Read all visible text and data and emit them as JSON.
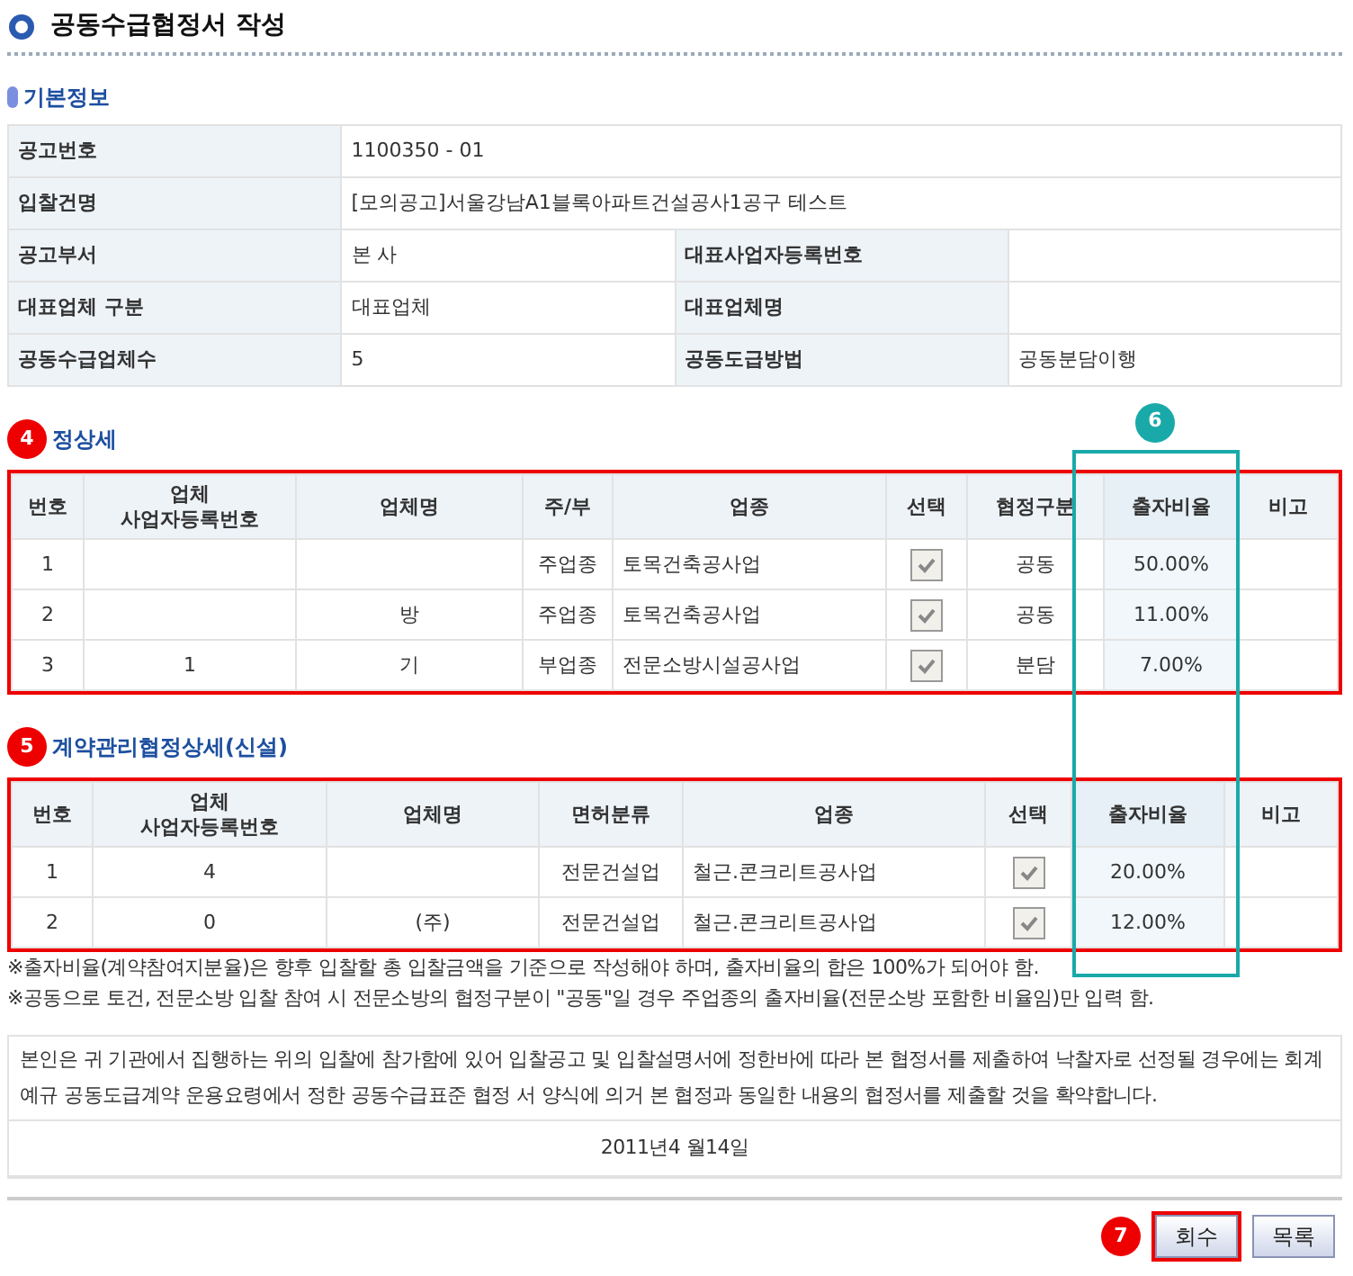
{
  "page_title": "공동수급협정서 작성",
  "basic_info": {
    "heading": "기본정보",
    "rows": [
      [
        {
          "label": "공고번호",
          "value": "1100350 - 01"
        }
      ],
      [
        {
          "label": "입찰건명",
          "value": "[모의공고]서울강남A1블록아파트건설공사1공구 테스트"
        }
      ],
      [
        {
          "label": "공고부서",
          "value": "본 사"
        },
        {
          "label": "대표사업자등록번호"
        }
      ],
      [
        {
          "label": "대표업체 구분",
          "value": "대표업체"
        },
        {
          "label": "대표업체명"
        }
      ],
      [
        {
          "label": "공동수급업체수",
          "value": "5"
        },
        {
          "label": "공동도급방법",
          "value": "공동분담이행"
        }
      ]
    ]
  },
  "agreement": {
    "heading": "정상세",
    "badge": "4",
    "outlined": true,
    "columns": [
      {
        "label": "번호",
        "kind": "text"
      },
      {
        "label": "업체\n사업자등록번호",
        "kind": "text"
      },
      {
        "label": "업체명",
        "kind": "text"
      },
      {
        "label": "주/부",
        "kind": "text"
      },
      {
        "label": "업종",
        "kind": "left"
      },
      {
        "label": "선택",
        "kind": "check"
      },
      {
        "label": "협정구분",
        "kind": "text"
      },
      {
        "label": "출자비율",
        "kind": "text",
        "highlighted": true
      },
      {
        "label": "비고",
        "kind": "text"
      }
    ],
    "rows": [
      {
        "cells": [
          {
            "text": "1"
          },
          {},
          {},
          {
            "text": "주업종"
          },
          {
            "text": "토목건축공사업"
          },
          {
            "checked": true
          },
          {
            "text": "공동"
          },
          {
            "text": "50.00%"
          },
          {}
        ]
      },
      {
        "cells": [
          {
            "text": "2"
          },
          {},
          {
            "text": "방"
          },
          {
            "text": "주업종"
          },
          {
            "text": "토목건축공사업"
          },
          {
            "checked": true
          },
          {
            "text": "공동"
          },
          {
            "text": "11.00%"
          },
          {}
        ]
      },
      {
        "cells": [
          {
            "text": "3"
          },
          {
            "text": "1"
          },
          {
            "text": "기"
          },
          {
            "text": "부업종"
          },
          {
            "text": "전문소방시설공사업"
          },
          {
            "checked": true
          },
          {
            "text": "분담"
          },
          {
            "text": "7.00%"
          },
          {}
        ]
      }
    ]
  },
  "contract": {
    "heading": "계약관리협정상세(신설)",
    "badge": "5",
    "outlined": true,
    "columns": [
      {
        "label": "번호",
        "kind": "text"
      },
      {
        "label": "업체\n사업자등록번호",
        "kind": "text"
      },
      {
        "label": "업체명",
        "kind": "text"
      },
      {
        "label": "면허분류",
        "kind": "text"
      },
      {
        "label": "업종",
        "kind": "left"
      },
      {
        "label": "선택",
        "kind": "check"
      },
      {
        "label": "출자비율",
        "kind": "text",
        "highlighted": true
      },
      {
        "label": "비고",
        "kind": "text"
      }
    ],
    "rows": [
      {
        "cells": [
          {
            "text": "1"
          },
          {
            "text": "4"
          },
          {},
          {
            "text": "전문건설업"
          },
          {
            "text": "철근.콘크리트공사업"
          },
          {
            "checked": true
          },
          {
            "text": "20.00%"
          },
          {}
        ]
      },
      {
        "cells": [
          {
            "text": "2"
          },
          {
            "text": "0"
          },
          {
            "text": "(주)"
          },
          {
            "text": "전문건설업"
          },
          {
            "text": "철근.콘크리트공사업"
          },
          {
            "checked": true
          },
          {
            "text": "12.00%"
          },
          {}
        ]
      }
    ]
  },
  "notes": [
    "※출자비율(계약참여지분율)은 향후 입찰할 총 입찰금액을 기준으로 작성해야 하며, 출자비율의 합은 100%가 되어야 함.",
    "※공동으로 토건, 전문소방 입찰 참여 시 전문소방의 협정구분이 \"공동\"일 경우 주업종의 출자비율(전문소방 포함한 비율임)만 입력 함."
  ],
  "pledge": "본인은 귀 기관에서 집행하는 위의 입찰에 참가함에 있어 입찰공고 및 입찰설명서에 정한바에 따라 본 협정서를 제출하여 낙찰자로 선정될 경우에는 회계예규 공동도급계약 운용요령에서 정한 공동수급표준 협정 서 양식에 의거 본 협정과 동일한 내용의 협정서를 제출할 것을 확약합니다.",
  "date": "2011년4 월14일",
  "column_highlight": {
    "badge": "6"
  },
  "buttons": {
    "badge": "7",
    "items": [
      {
        "label": "회수",
        "outlined": true
      },
      {
        "label": "목록",
        "outlined": false
      }
    ]
  }
}
